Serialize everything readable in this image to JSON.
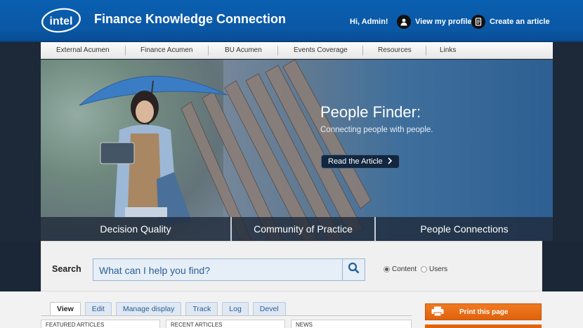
{
  "header": {
    "logo_text": "intel",
    "site_title": "Finance Knowledge Connection",
    "greeting": "Hi, Admin!",
    "profile_link": "View my profile",
    "create_link": "Create an article"
  },
  "nav": {
    "items": [
      "External Acumen",
      "Finance Acumen",
      "BU Acumen",
      "Events Coverage",
      "Resources",
      "Links"
    ]
  },
  "hero": {
    "title": "People Finder:",
    "subtitle": "Connecting people with people.",
    "button_label": "Read the Article",
    "tabs": [
      "Decision Quality",
      "Community of Practice",
      "People Connections"
    ]
  },
  "search": {
    "label": "Search",
    "placeholder": "What can I help you find?",
    "options": [
      {
        "label": "Content",
        "selected": true
      },
      {
        "label": "Users",
        "selected": false
      }
    ]
  },
  "page_tabs": [
    "View",
    "Edit",
    "Manage display",
    "Track",
    "Log",
    "Devel"
  ],
  "columns": [
    "FEATURED ARTICLES",
    "RECENT ARTICLES",
    "NEWS"
  ],
  "actions": {
    "print_label": "Print this page"
  },
  "colors": {
    "header_blue": "#0a5fb0",
    "accent_orange": "#e5630d",
    "link_blue": "#2a5e95"
  }
}
